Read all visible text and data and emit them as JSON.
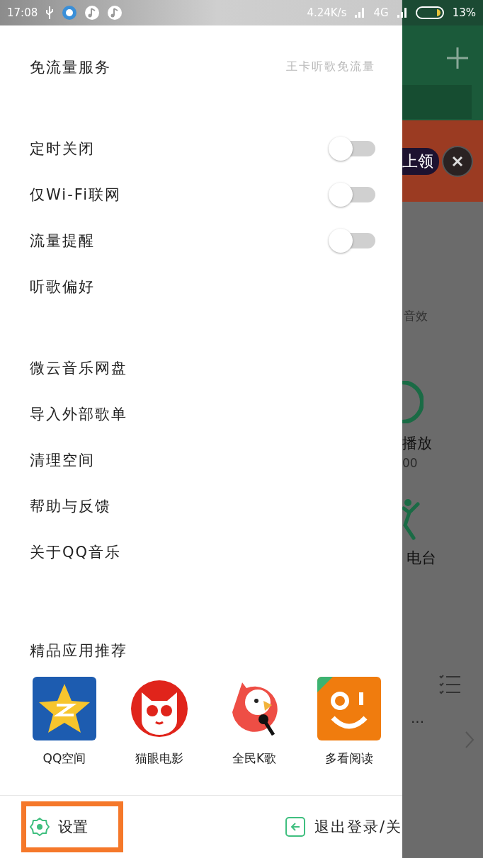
{
  "status_bar": {
    "time": "17:08",
    "speed": "4.24K/s",
    "network": "4G",
    "battery": "13%"
  },
  "sections": [
    {
      "items": [
        {
          "kind": "link",
          "label": "免流量服务",
          "detail": "王卡听歌免流量"
        }
      ]
    },
    {
      "items": [
        {
          "kind": "toggle",
          "label": "定时关闭",
          "on": false
        },
        {
          "kind": "toggle",
          "label": "仅Wi-Fi联网",
          "on": false
        },
        {
          "kind": "toggle",
          "label": "流量提醒",
          "on": false
        },
        {
          "kind": "link",
          "label": "听歌偏好"
        }
      ]
    },
    {
      "items": [
        {
          "kind": "link",
          "label": "微云音乐网盘"
        },
        {
          "kind": "link",
          "label": "导入外部歌单"
        },
        {
          "kind": "link",
          "label": "清理空间"
        },
        {
          "kind": "link",
          "label": "帮助与反馈"
        },
        {
          "kind": "link",
          "label": "关于QQ音乐"
        }
      ]
    }
  ],
  "apps": {
    "title": "精品应用推荐",
    "items": [
      {
        "kind": "star",
        "label": "QQ空间"
      },
      {
        "kind": "cat",
        "label": "猫眼电影"
      },
      {
        "kind": "bird",
        "label": "全民K歌"
      },
      {
        "kind": "smile",
        "label": "多看阅读"
      }
    ]
  },
  "footer": {
    "settings": {
      "label": "设置",
      "highlighted": true
    },
    "logout": {
      "label": "退出登录/关"
    }
  },
  "background": {
    "banner": "上领",
    "effects": "音效",
    "play": "播放",
    "count": "00",
    "radio": "电台",
    "more": "···"
  }
}
